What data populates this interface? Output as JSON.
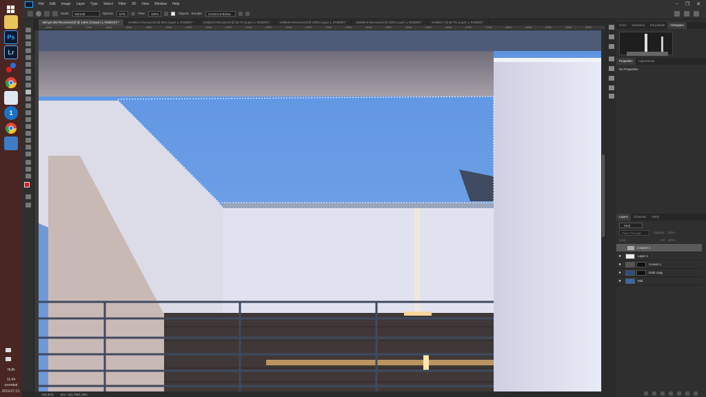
{
  "taskbar": {
    "apps": [
      {
        "name": "windows-start-icon"
      },
      {
        "name": "file-explorer-icon"
      },
      {
        "name": "photoshop-app-icon",
        "label": "Ps"
      },
      {
        "name": "lightroom-app-icon",
        "label": "Lr"
      },
      {
        "name": "colorful-app-icon"
      },
      {
        "name": "chrome-app-icon"
      },
      {
        "name": "document-app-icon"
      },
      {
        "name": "app-1-icon",
        "label": "1"
      },
      {
        "name": "chrome-app-icon-2"
      },
      {
        "name": "image-viewer-icon"
      }
    ],
    "lang": "HUN",
    "time": "11:44",
    "day": "szombat",
    "date": "2019.07.13."
  },
  "menu": [
    "File",
    "Edit",
    "Image",
    "Layer",
    "Type",
    "Select",
    "Filter",
    "3D",
    "View",
    "Window",
    "Help"
  ],
  "options": {
    "mode_label": "Mode:",
    "mode_value": "Normal",
    "opacity_label": "Opacity:",
    "opacity_value": "87%",
    "flow_label": "Flow:",
    "flow_value": "100%",
    "aligned_label": "Aligned",
    "sample_label": "Sample:",
    "sample_value": "Current & Below"
  },
  "tabs": [
    {
      "label": "Bényei-262-Recovered.tif @ 140% (Csoport 1, RGB/16*) *",
      "active": true
    },
    {
      "label": "Untitled-1-Recovered @ 50% (Layer 1, RGB/8#) *",
      "active": false
    },
    {
      "label": "Untitled-3-Recovered @ 66.7% (Layer 1, RGB/8#) *",
      "active": false
    },
    {
      "label": "Untitled-4-Recovered @ 100% (Layer 1, RGB/8#) *",
      "active": false
    },
    {
      "label": "Untitled-5-Recovered @ 100% (Layer 1, RGB/8#) *",
      "active": false
    },
    {
      "label": "Untitled-7 @ 66.7% (Layer 1, RGB/8#) *",
      "active": false
    }
  ],
  "ruler_ticks": [
    "1650",
    "1700",
    "1750",
    "1800",
    "1850",
    "1900",
    "1950",
    "2000",
    "2050",
    "2100",
    "2150",
    "2200",
    "2250",
    "2300",
    "2350",
    "2400",
    "2450",
    "2500",
    "2550",
    "2600",
    "2650",
    "2700",
    "2750",
    "2800",
    "2850",
    "2900",
    "2950",
    "3000"
  ],
  "status": {
    "zoom": "140.34%",
    "doc": "Doc: 161,7M/1,46G"
  },
  "top_panel_tabs": [
    "Color",
    "Swatches",
    "Könyvtárak",
    "Histogram"
  ],
  "props_tabs": [
    "Properties",
    "Adjustments"
  ],
  "props_text": "No Properties",
  "layers_tabs": [
    "Layers",
    "Channels",
    "Paths"
  ],
  "layers_kind": "Kind",
  "layers_blend": "Pass Through",
  "layers_opacity_label": "Opacity:",
  "layers_opacity_value": "100%",
  "layers_lock_label": "Lock:",
  "layers_fill_label": "Fill:",
  "layers_fill_value": "100%",
  "layers": [
    {
      "name": "Csoport 1",
      "kind": "group",
      "selected": true
    },
    {
      "name": "Layer 1",
      "kind": "pixel",
      "selected": false
    },
    {
      "name": "Curves 1",
      "kind": "adjustment",
      "selected": false
    },
    {
      "name": "Dark copy",
      "kind": "pixel",
      "selected": false
    },
    {
      "name": "Mid",
      "kind": "pixel",
      "selected": false
    }
  ],
  "colors": {
    "sky": "#6a9fe0",
    "wall": "#dfe3f2",
    "beam": "#c9c1c6",
    "foreground": "#e0191c"
  }
}
